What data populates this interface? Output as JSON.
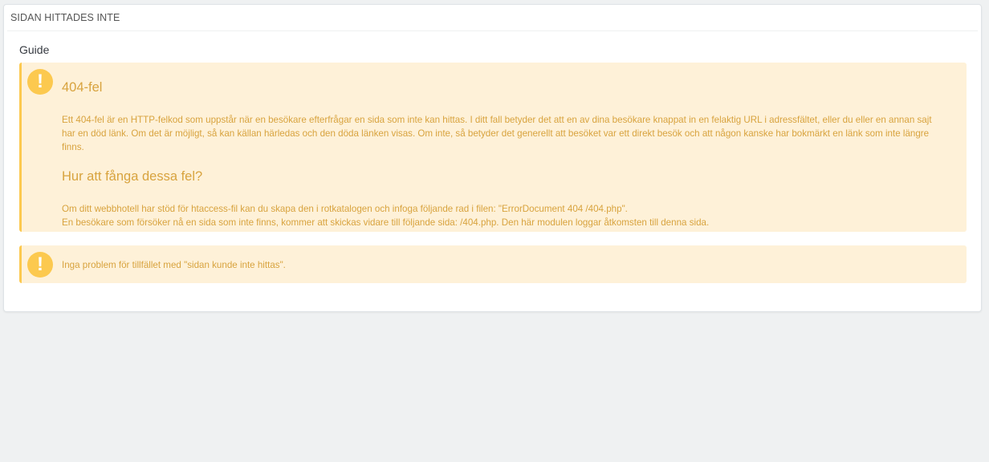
{
  "panel": {
    "heading": "SIDAN HITTADES INTE"
  },
  "guide": {
    "section_title": "Guide",
    "alert": {
      "icon": "exclamation-circle-icon",
      "title": "404-fel",
      "intro": "Ett 404-fel är en HTTP-felkod som uppstår när en besökare efterfrågar en sida som inte kan hittas. I ditt fall betyder det att en av dina besökare knappat in en felaktig URL i adressfältet, eller du eller en annan sajt har en död länk. Om det är möjligt, så kan källan härledas och den döda länken visas. Om inte, så betyder det generellt att besöket var ett direkt besök och att någon kanske har bokmärkt en länk som inte längre finns.",
      "catch_title": "Hur att fånga dessa fel?",
      "catch_line1": "Om ditt webbhotell har stöd för htaccess-fil kan du skapa den i rotkatalogen och infoga följande rad i filen: \"ErrorDocument 404 /404.php\".",
      "catch_line2": "En besökare som försöker nå en sida som inte finns, kommer att skickas vidare till följande sida: /404.php. Den här modulen loggar åtkomsten till denna sida."
    }
  },
  "status": {
    "icon": "exclamation-circle-icon",
    "message": "Inga problem för tillfället med \"sidan kunde inte hittas\"."
  },
  "colors": {
    "background": "#eff1f2",
    "alert_background": "#fef1d8",
    "alert_accent": "#fcc94f",
    "alert_text": "#d8a33e"
  }
}
